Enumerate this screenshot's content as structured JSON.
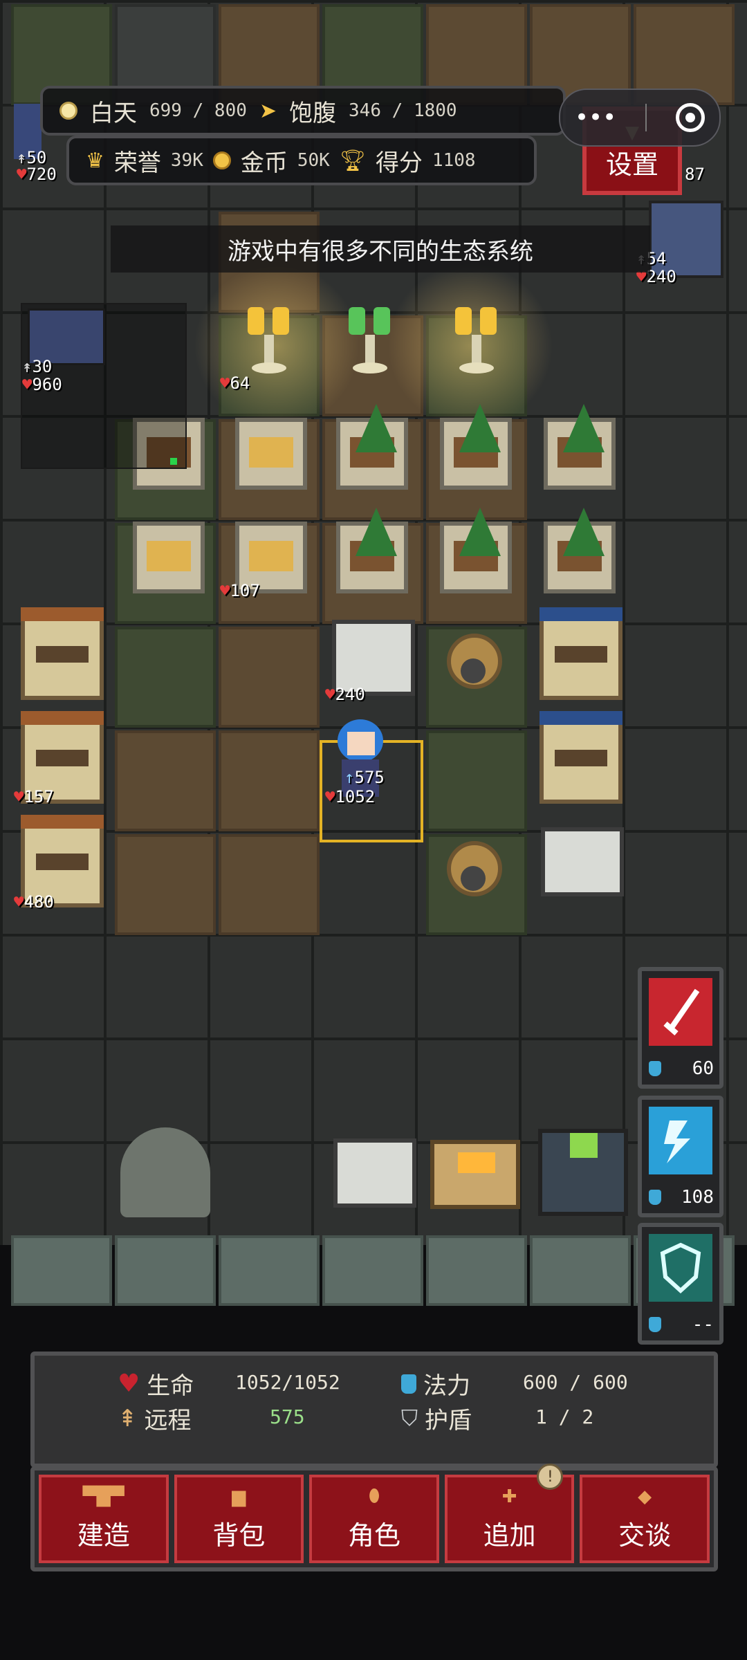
{
  "hud": {
    "day_label": "白天",
    "day_value": "699 / 800",
    "hunger_label": "饱腹",
    "hunger_value": "346 / 1800",
    "honor_label": "荣誉",
    "honor_value": "39K",
    "gold_label": "金币",
    "gold_value": "50K",
    "score_label": "得分",
    "score_value": "1108",
    "more_icon": "•••",
    "settings_label": "设置"
  },
  "tooltip": "游戏中有很多不同的生态系统",
  "map_labels": {
    "left_tower_atk": "50",
    "left_tower_hp": "720",
    "right_tower_atk": "54",
    "right_tower_hp": "240",
    "right_top_hp": "87",
    "minimap_atk": "30",
    "minimap_hp": "960",
    "candle_hp": "64",
    "planter_hp": "107",
    "machine_hp": "240",
    "hero_range": "575",
    "hero_hp": "1052",
    "stall_hp_1": "157",
    "stall_hp_2": "480"
  },
  "skills": [
    {
      "name": "sword-skill",
      "cost": "60",
      "color": "#c8262f"
    },
    {
      "name": "lightning-skill",
      "cost": "108",
      "color": "#2aa0d8"
    },
    {
      "name": "shield-skill",
      "cost": "--",
      "color": "#1f6f66"
    }
  ],
  "stats": {
    "life_label": "生命",
    "life_value": "1052/1052",
    "mana_label": "法力",
    "mana_value": "600 / 600",
    "range_label": "远程",
    "range_value": "575",
    "shield_label": "护盾",
    "shield_value": "1 / 2"
  },
  "buttons": [
    {
      "label": "建造",
      "icon": "hammer-icon"
    },
    {
      "label": "背包",
      "icon": "bag-icon"
    },
    {
      "label": "角色",
      "icon": "character-icon"
    },
    {
      "label": "追加",
      "icon": "plus-icon"
    },
    {
      "label": "交谈",
      "icon": "chat-icon"
    }
  ],
  "badge": "!"
}
